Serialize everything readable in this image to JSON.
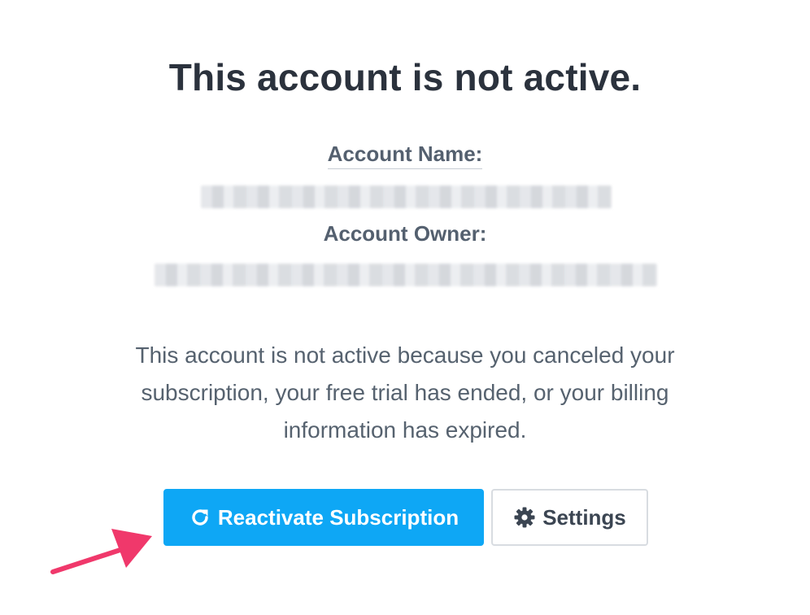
{
  "page": {
    "title": "This account is not active.",
    "account_name_label": "Account Name:",
    "account_owner_label": "Account Owner:",
    "message": "This account is not active because you canceled your subscription, your free trial has ended, or your billing information has expired."
  },
  "actions": {
    "reactivate_label": "Reactivate Subscription",
    "settings_label": "Settings"
  },
  "icons": {
    "reactivate": "refresh-icon",
    "settings": "gear-icon",
    "annotation": "arrow-annotation"
  },
  "colors": {
    "primary_button": "#0ea7f5",
    "annotation_arrow": "#f0386b",
    "title_text": "#2b323d",
    "body_text": "#56626f"
  }
}
